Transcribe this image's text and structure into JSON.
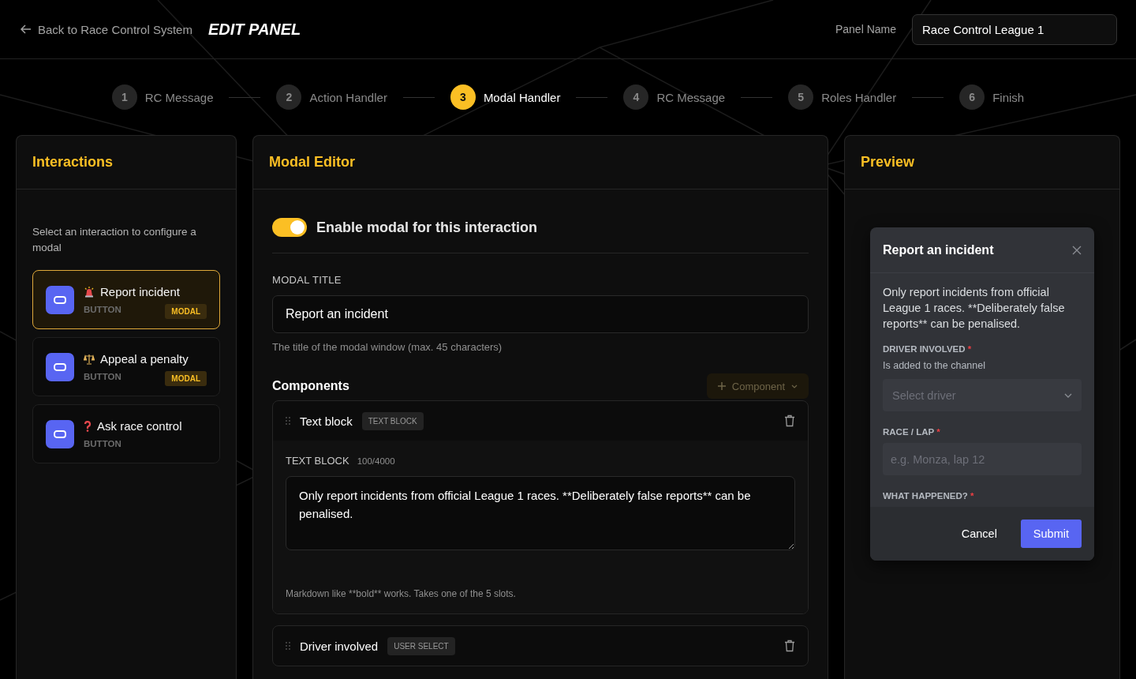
{
  "header": {
    "back_link": "Back to Race Control System",
    "title": "EDIT PANEL",
    "panel_name": {
      "label": "Panel Name",
      "value": "Race Control League 1"
    }
  },
  "steps": [
    {
      "number": "1",
      "label": "RC Message",
      "selected": false
    },
    {
      "number": "2",
      "label": "Action Handler",
      "selected": false
    },
    {
      "number": "3",
      "label": "Modal Handler",
      "selected": true
    },
    {
      "number": "4",
      "label": "RC Message",
      "selected": false
    },
    {
      "number": "5",
      "label": "Roles Handler",
      "selected": false
    },
    {
      "number": "6",
      "label": "Finish",
      "selected": false
    }
  ],
  "interactions": {
    "title": "Interactions",
    "hint": "Select an interaction to configure a modal",
    "items": [
      {
        "kind": "siren",
        "label": "Report incident",
        "type": "BUTTON",
        "badge": "MODAL",
        "selected": true
      },
      {
        "kind": "scales",
        "label": "Appeal a penalty",
        "type": "BUTTON",
        "badge": "MODAL",
        "selected": false
      },
      {
        "kind": "question",
        "label": "Ask race control",
        "type": "BUTTON",
        "selected": false
      }
    ]
  },
  "modal_editor": {
    "title": "Modal Editor",
    "enable": {
      "label": "Enable modal for this interaction",
      "on": true
    },
    "modal_title": {
      "label": "MODAL TITLE",
      "value": "Report an incident",
      "help": "The title of the modal window (max. 45 characters)"
    },
    "components": {
      "title": "Components",
      "add_button": {
        "label": "Component",
        "disabled": true
      },
      "items": [
        {
          "kind": "text_block",
          "name": "Text block",
          "tag": "TEXT BLOCK",
          "field_label": "TEXT BLOCK",
          "count": "100/4000",
          "value": "Only report incidents from official League 1 races. **Deliberately false reports** can be penalised.",
          "hint": "Markdown like **bold** works. Takes one of the 5 slots."
        },
        {
          "kind": "user_select",
          "name": "Driver involved",
          "tag": "USER SELECT"
        }
      ]
    }
  },
  "preview": {
    "title": "Preview",
    "modal": {
      "title": "Report an incident",
      "description": "Only report incidents from official League 1 races. **Deliberately false reports** can be penalised.",
      "fields": [
        {
          "kind": "select",
          "label": "DRIVER INVOLVED",
          "required_mark": "*",
          "hint": "Is added to the channel",
          "placeholder": "Select driver"
        },
        {
          "kind": "text",
          "label": "RACE / LAP",
          "required_mark": "*",
          "placeholder": "e.g. Monza, lap 12"
        },
        {
          "kind": "paragraph",
          "label": "WHAT HAPPENED?",
          "required_mark": "*"
        }
      ],
      "cancel": "Cancel",
      "submit": "Submit"
    }
  }
}
